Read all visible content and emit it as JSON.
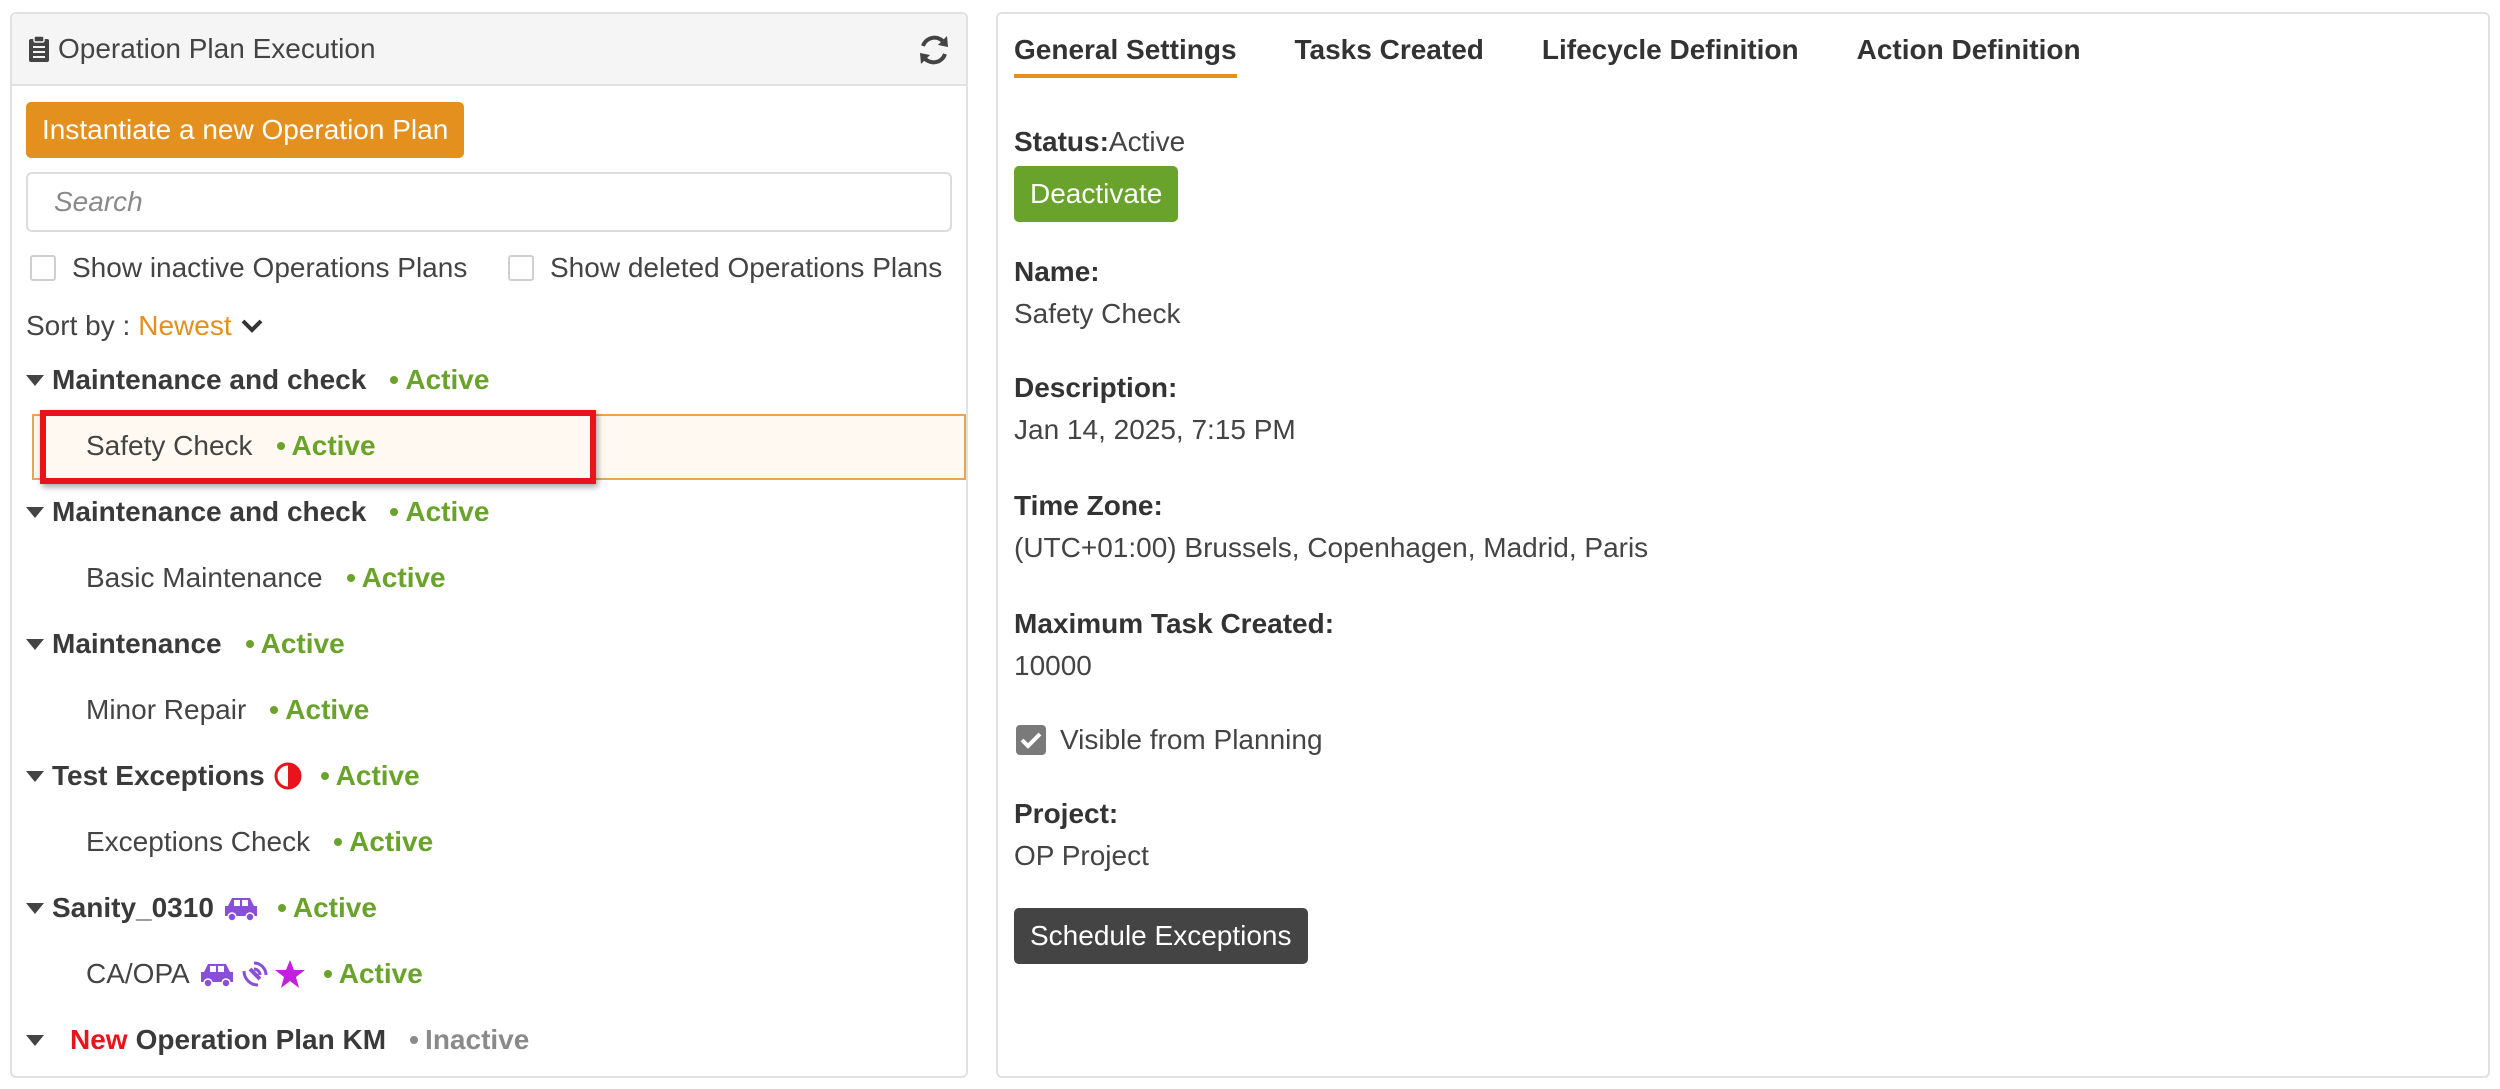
{
  "left_panel": {
    "title": "Operation Plan Execution",
    "instantiate_label": "Instantiate a new Operation Plan",
    "search_placeholder": "Search",
    "show_inactive_label": "Show inactive Operations Plans",
    "show_deleted_label": "Show deleted Operations Plans",
    "sort_label": "Sort by :",
    "sort_value": "Newest",
    "groups": [
      {
        "name": "Maintenance and check",
        "status": "Active",
        "children": [
          {
            "name": "Safety Check",
            "status": "Active",
            "selected": true
          }
        ]
      },
      {
        "name": "Maintenance and check",
        "status": "Active",
        "children": [
          {
            "name": "Basic Maintenance",
            "status": "Active"
          }
        ]
      },
      {
        "name": "Maintenance",
        "status": "Active",
        "children": [
          {
            "name": "Minor Repair",
            "status": "Active"
          }
        ]
      },
      {
        "name": "Test Exceptions",
        "status": "Active",
        "icon": "half-circle-icon",
        "children": [
          {
            "name": "Exceptions Check",
            "status": "Active"
          }
        ]
      },
      {
        "name": "Sanity_0310",
        "status": "Active",
        "icon": "car-icon",
        "children": [
          {
            "name": "CA/OPA",
            "status": "Active",
            "icons": [
              "car-icon",
              "satellite-icon",
              "star-icon"
            ]
          }
        ]
      },
      {
        "new_label": "New",
        "name": "Operation Plan KM",
        "status": "Inactive"
      }
    ]
  },
  "right_panel": {
    "tabs": [
      {
        "label": "General Settings",
        "active": true
      },
      {
        "label": "Tasks Created"
      },
      {
        "label": "Lifecycle Definition"
      },
      {
        "label": "Action Definition"
      }
    ],
    "status_label": "Status:",
    "status_value": "Active",
    "deactivate_label": "Deactivate",
    "name_label": "Name:",
    "name_value": "Safety Check",
    "description_label": "Description:",
    "description_value": "Jan 14, 2025, 7:15 PM",
    "timezone_label": "Time Zone:",
    "timezone_value": "(UTC+01:00) Brussels, Copenhagen, Madrid, Paris",
    "max_task_label": "Maximum Task Created:",
    "max_task_value": "10000",
    "visible_label": "Visible from Planning",
    "visible_checked": true,
    "project_label": "Project:",
    "project_value": "OP Project",
    "schedule_label": "Schedule Exceptions"
  },
  "colors": {
    "accent_orange": "#e3901f",
    "active_green": "#6aa32b",
    "highlight_red": "#e8131b",
    "icon_purple": "#8a4fd8",
    "star_magenta": "#c21fe0"
  }
}
